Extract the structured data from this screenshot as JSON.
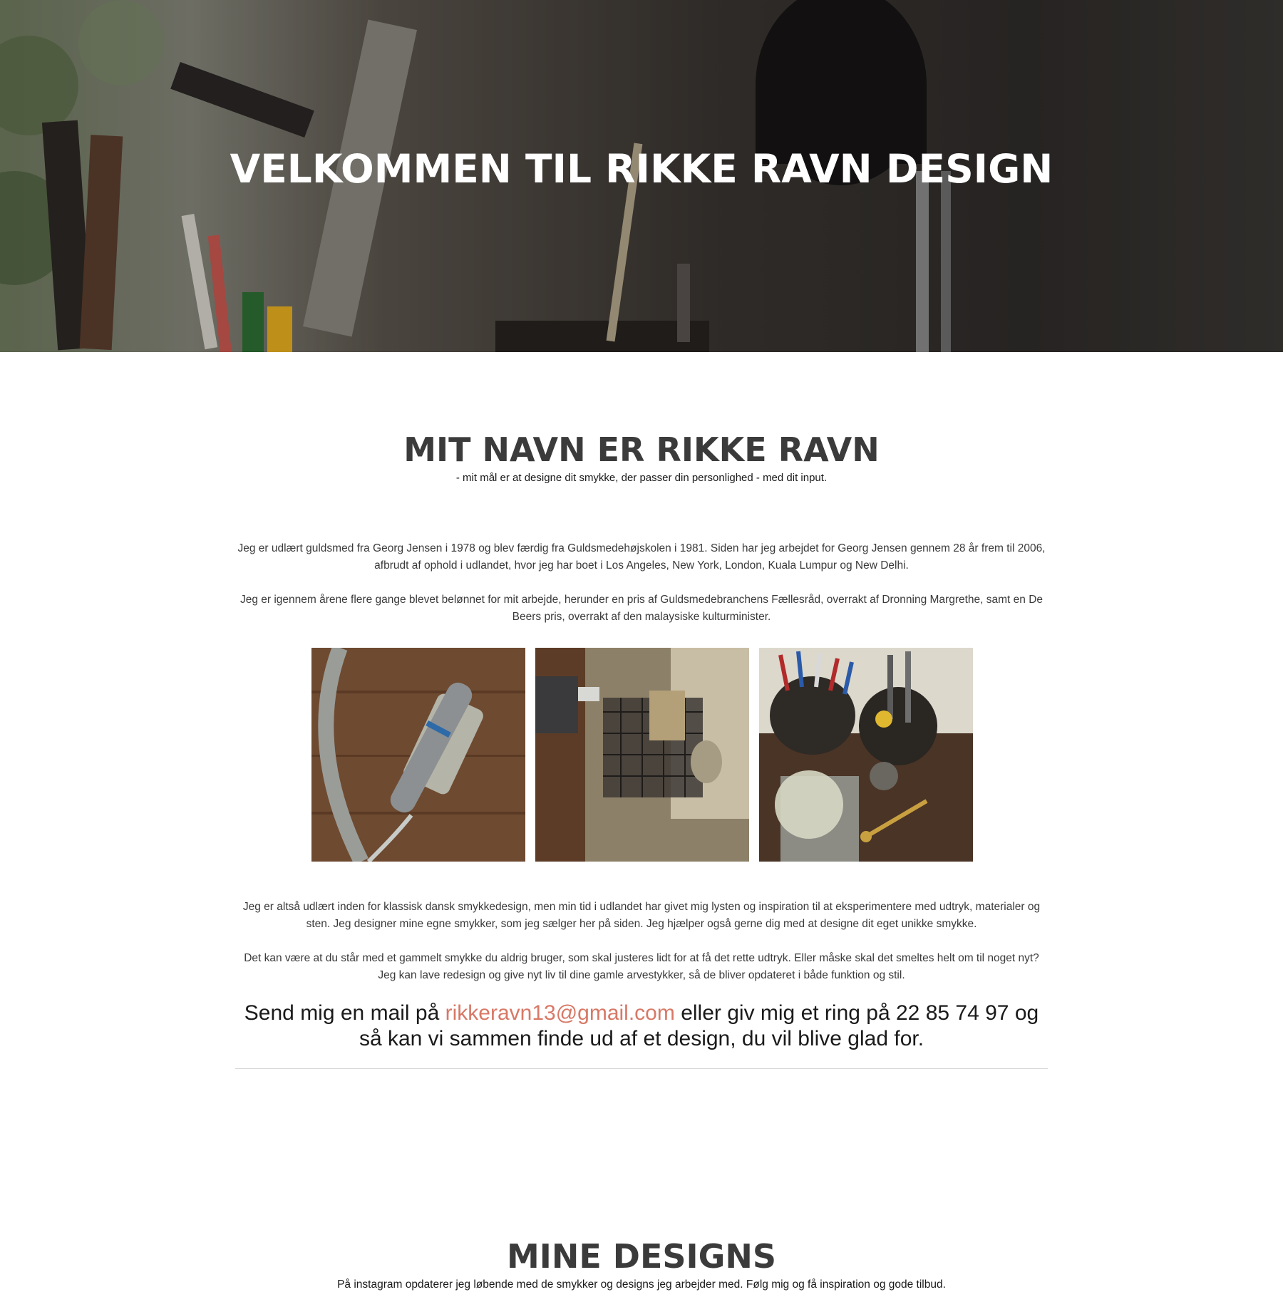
{
  "hero": {
    "title": "VELKOMMEN TIL RIKKE RAVN DESIGN"
  },
  "about": {
    "title": "MIT NAVN ER RIKKE RAVN",
    "subtitle": "- mit mål er at designe dit smykke, der passer din personlighed - med dit input.",
    "paragraphs": [
      "Jeg er udlært guldsmed fra Georg Jensen i 1978 og blev færdig fra Guldsmedehøjskolen i 1981. Siden har jeg arbejdet for Georg Jensen gennem 28 år frem til 2006, afbrudt af ophold i udlandet, hvor jeg har boet i Los Angeles, New York, London, Kuala Lumpur og New Delhi.",
      "Jeg er igennem årene flere gange blevet belønnet for mit arbejde, herunder en pris af Guldsmedebranchens Fællesråd, overrakt af Dronning Margrethe, samt en De Beers pris, overrakt af den malaysiske kulturminister.",
      "Jeg er altså udlært inden for klassisk dansk smykkedesign, men min tid i udlandet har givet mig lysten og inspiration til at eksperimentere med udtryk, materialer og sten. Jeg designer mine egne smykker, som jeg sælger her på siden. Jeg hjælper også gerne dig med at designe dit eget unikke smykke.",
      "Det kan være at du står med et gammelt smykke du aldrig bruger, som skal justeres lidt for at få det rette udtryk. Eller måske skal det smeltes helt om til noget nyt? Jeg kan lave redesign og give nyt liv til dine gamle arvestykker, så de bliver opdateret i både funktion og stil."
    ],
    "gallery": [
      {
        "icon": "polishing-tool-photo"
      },
      {
        "icon": "soldering-block-photo"
      },
      {
        "icon": "workbench-tools-photo"
      }
    ],
    "cta": {
      "before": "Send mig en mail på ",
      "email": "rikkeravn13@gmail.com",
      "after": " eller giv mig et ring på 22 85 74 97 og så kan vi sammen finde ud af et design, du vil blive glad for."
    }
  },
  "designs": {
    "title": "MINE DESIGNS",
    "subtitle": "På instagram opdaterer jeg løbende med de smykker og designs jeg arbejder med. Følg mig og få inspiration og gode tilbud."
  },
  "colors": {
    "accent_link": "#d87866",
    "heading": "#3b3b3b",
    "divider": "#d8d8d8"
  }
}
